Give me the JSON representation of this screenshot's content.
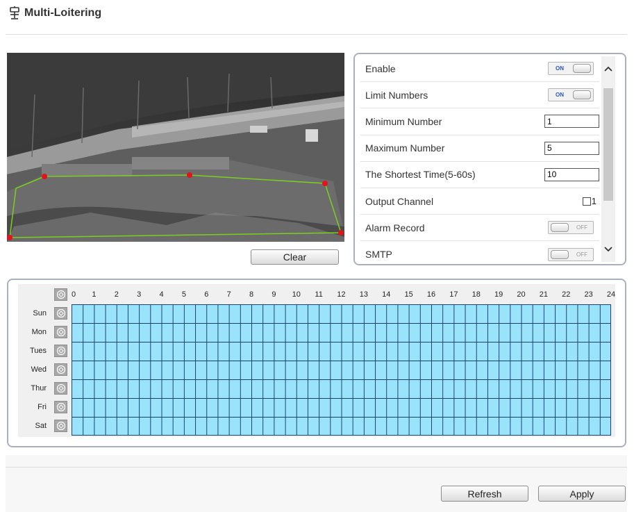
{
  "header": {
    "title": "Multi-Loitering",
    "icon": "camera-pin-icon"
  },
  "video": {
    "clear_label": "Clear"
  },
  "settings": {
    "rows": [
      {
        "label": "Enable",
        "type": "toggle",
        "value": "ON"
      },
      {
        "label": "Limit Numbers",
        "type": "toggle",
        "value": "ON"
      },
      {
        "label": "Minimum Number",
        "type": "input",
        "value": "1"
      },
      {
        "label": "Maximum Number",
        "type": "input",
        "value": "5"
      },
      {
        "label": "The Shortest Time(5-60s)",
        "type": "input",
        "value": "10"
      },
      {
        "label": "Output Channel",
        "type": "checkbox",
        "value": "1",
        "checked": false
      },
      {
        "label": "Alarm Record",
        "type": "toggle",
        "value": "OFF"
      },
      {
        "label": "SMTP",
        "type": "toggle",
        "value": "OFF"
      }
    ]
  },
  "schedule": {
    "hours": [
      "0",
      "1",
      "2",
      "3",
      "4",
      "5",
      "6",
      "7",
      "8",
      "9",
      "10",
      "11",
      "12",
      "13",
      "14",
      "15",
      "16",
      "17",
      "18",
      "19",
      "20",
      "21",
      "22",
      "23",
      "24"
    ],
    "days": [
      "Sun",
      "Mon",
      "Tues",
      "Wed",
      "Thur",
      "Fri",
      "Sat"
    ],
    "fill_color": "#99e3fb",
    "line_color": "#1f3f6f"
  },
  "footer": {
    "refresh_label": "Refresh",
    "apply_label": "Apply"
  }
}
